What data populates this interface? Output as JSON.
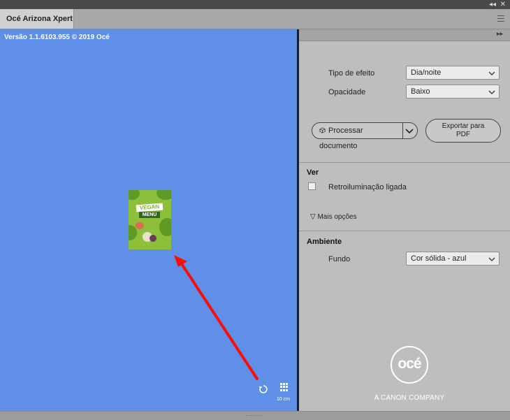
{
  "window": {
    "tab_title": "Océ Arizona Xpert",
    "controls": {
      "collapse": "◂◂",
      "close": "✕"
    }
  },
  "canvas": {
    "version_text": "Versão 1.1.6103.955 © 2019 Océ",
    "background_color": "#5f8fe6",
    "thumbnail": {
      "line1": "VEGAN",
      "line2": "MENU"
    },
    "scale_label": "10 cm"
  },
  "panel": {
    "expand_label": "▸▸",
    "effect_type": {
      "label": "Tipo de efeito",
      "value": "Dia/noite"
    },
    "opacity": {
      "label": "Opacidade",
      "value": "Baixo"
    },
    "process_button": "Processar documento",
    "export_button": "Exportar para PDF",
    "view_section": {
      "title": "Ver",
      "backlight_label": "Retroiluminação ligada",
      "more_options": "▽ Mais opções"
    },
    "environment_section": {
      "title": "Ambiente",
      "background_label": "Fundo",
      "background_value": "Cor sólida - azul"
    },
    "brand": {
      "logo_text": "océ",
      "tagline": "A CANON COMPANY"
    }
  }
}
